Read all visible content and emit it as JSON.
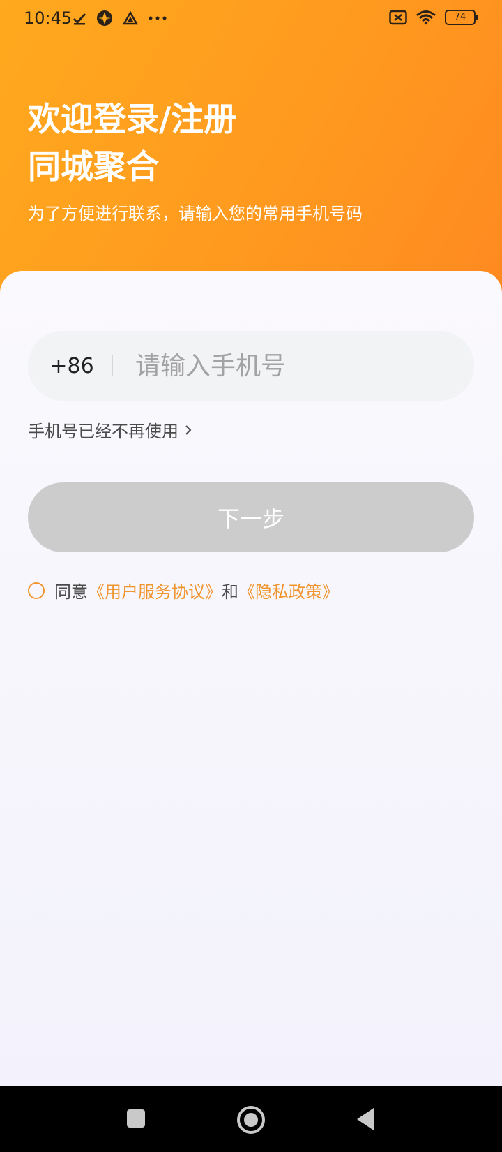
{
  "status_bar": {
    "time": "10:45",
    "battery": "74",
    "icons": [
      "download-done-icon",
      "app-icon",
      "triangle-app-icon",
      "more-dots-icon",
      "sim-off-icon",
      "wifi-icon",
      "battery-icon"
    ]
  },
  "header": {
    "title_line1": "欢迎登录/注册",
    "title_line2": "同城聚合",
    "subtitle": "为了方便进行联系，请输入您的常用手机号码"
  },
  "form": {
    "country_code": "+86",
    "phone_placeholder": "请输入手机号",
    "phone_value": "",
    "unused_phone_link": "手机号已经不再使用",
    "next_button": "下一步"
  },
  "agreement": {
    "prefix": "同意",
    "user_agreement": "《用户服务协议》",
    "and": "和",
    "privacy_policy": "《隐私政策》"
  },
  "colors": {
    "brand_orange": "#ff9a1f",
    "link_orange": "#f0942e",
    "disabled_button": "#cccccc"
  }
}
